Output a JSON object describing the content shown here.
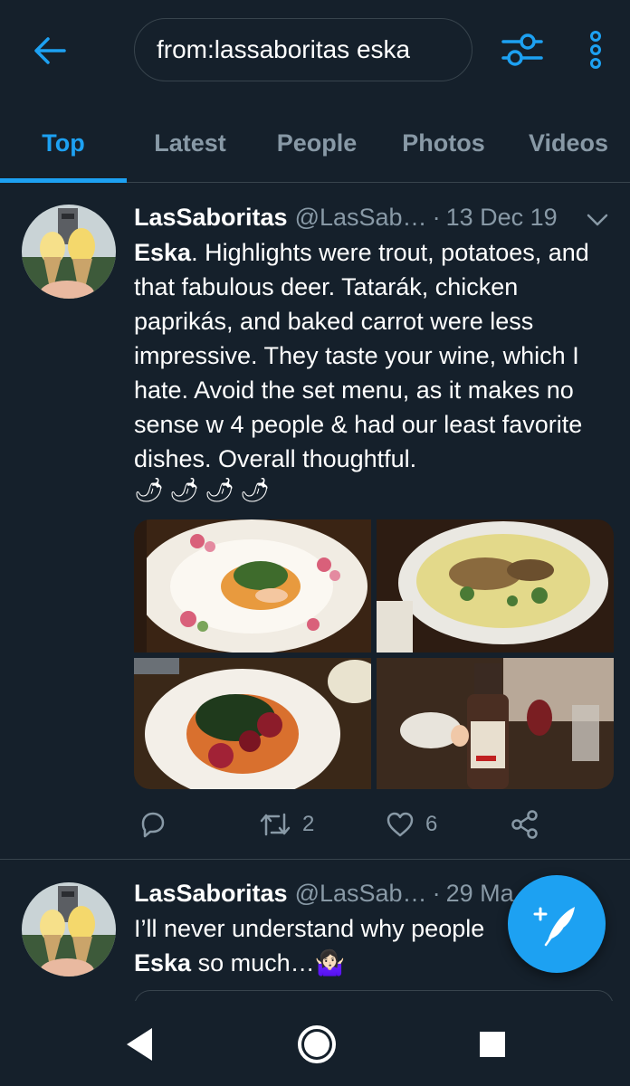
{
  "search": {
    "query": "from:lassaboritas eska"
  },
  "tabs": [
    {
      "label": "Top",
      "active": true
    },
    {
      "label": "Latest",
      "active": false
    },
    {
      "label": "People",
      "active": false
    },
    {
      "label": "Photos",
      "active": false
    },
    {
      "label": "Videos",
      "active": false
    }
  ],
  "tweets": [
    {
      "display_name": "LasSaboritas",
      "handle": "@LasSab…",
      "separator": "·",
      "date": "13 Dec 19",
      "body_bold": "Eska",
      "body_text": ". Highlights were trout, potatoes, and that fabulous deer. Tatarák, chicken paprikás, and baked carrot were less impressive. They taste your wine, which I hate. Avoid the set menu, as it makes no sense w 4 people & had our least favorite dishes. Overall thoughtful.",
      "chilis": [
        "🌶",
        "🌶",
        "🌶",
        "🌶"
      ],
      "media_icons": [
        "plate-of-fish-photo",
        "plate-of-risotto-photo",
        "plate-of-beets-photo",
        "wine-bottle-photo"
      ],
      "retweets": "2",
      "likes": "6"
    },
    {
      "display_name": "LasSaboritas",
      "handle": "@LasSab…",
      "separator": "·",
      "date": "29 Ma",
      "body_line1": "I’ll never understand why people",
      "body_bold": "Eska",
      "body_line2": " so much…🤷🏻‍♀️"
    }
  ],
  "colors": {
    "background": "#15202b",
    "accent": "#1da1f2",
    "muted": "#8899a6",
    "divider": "#38444d"
  }
}
